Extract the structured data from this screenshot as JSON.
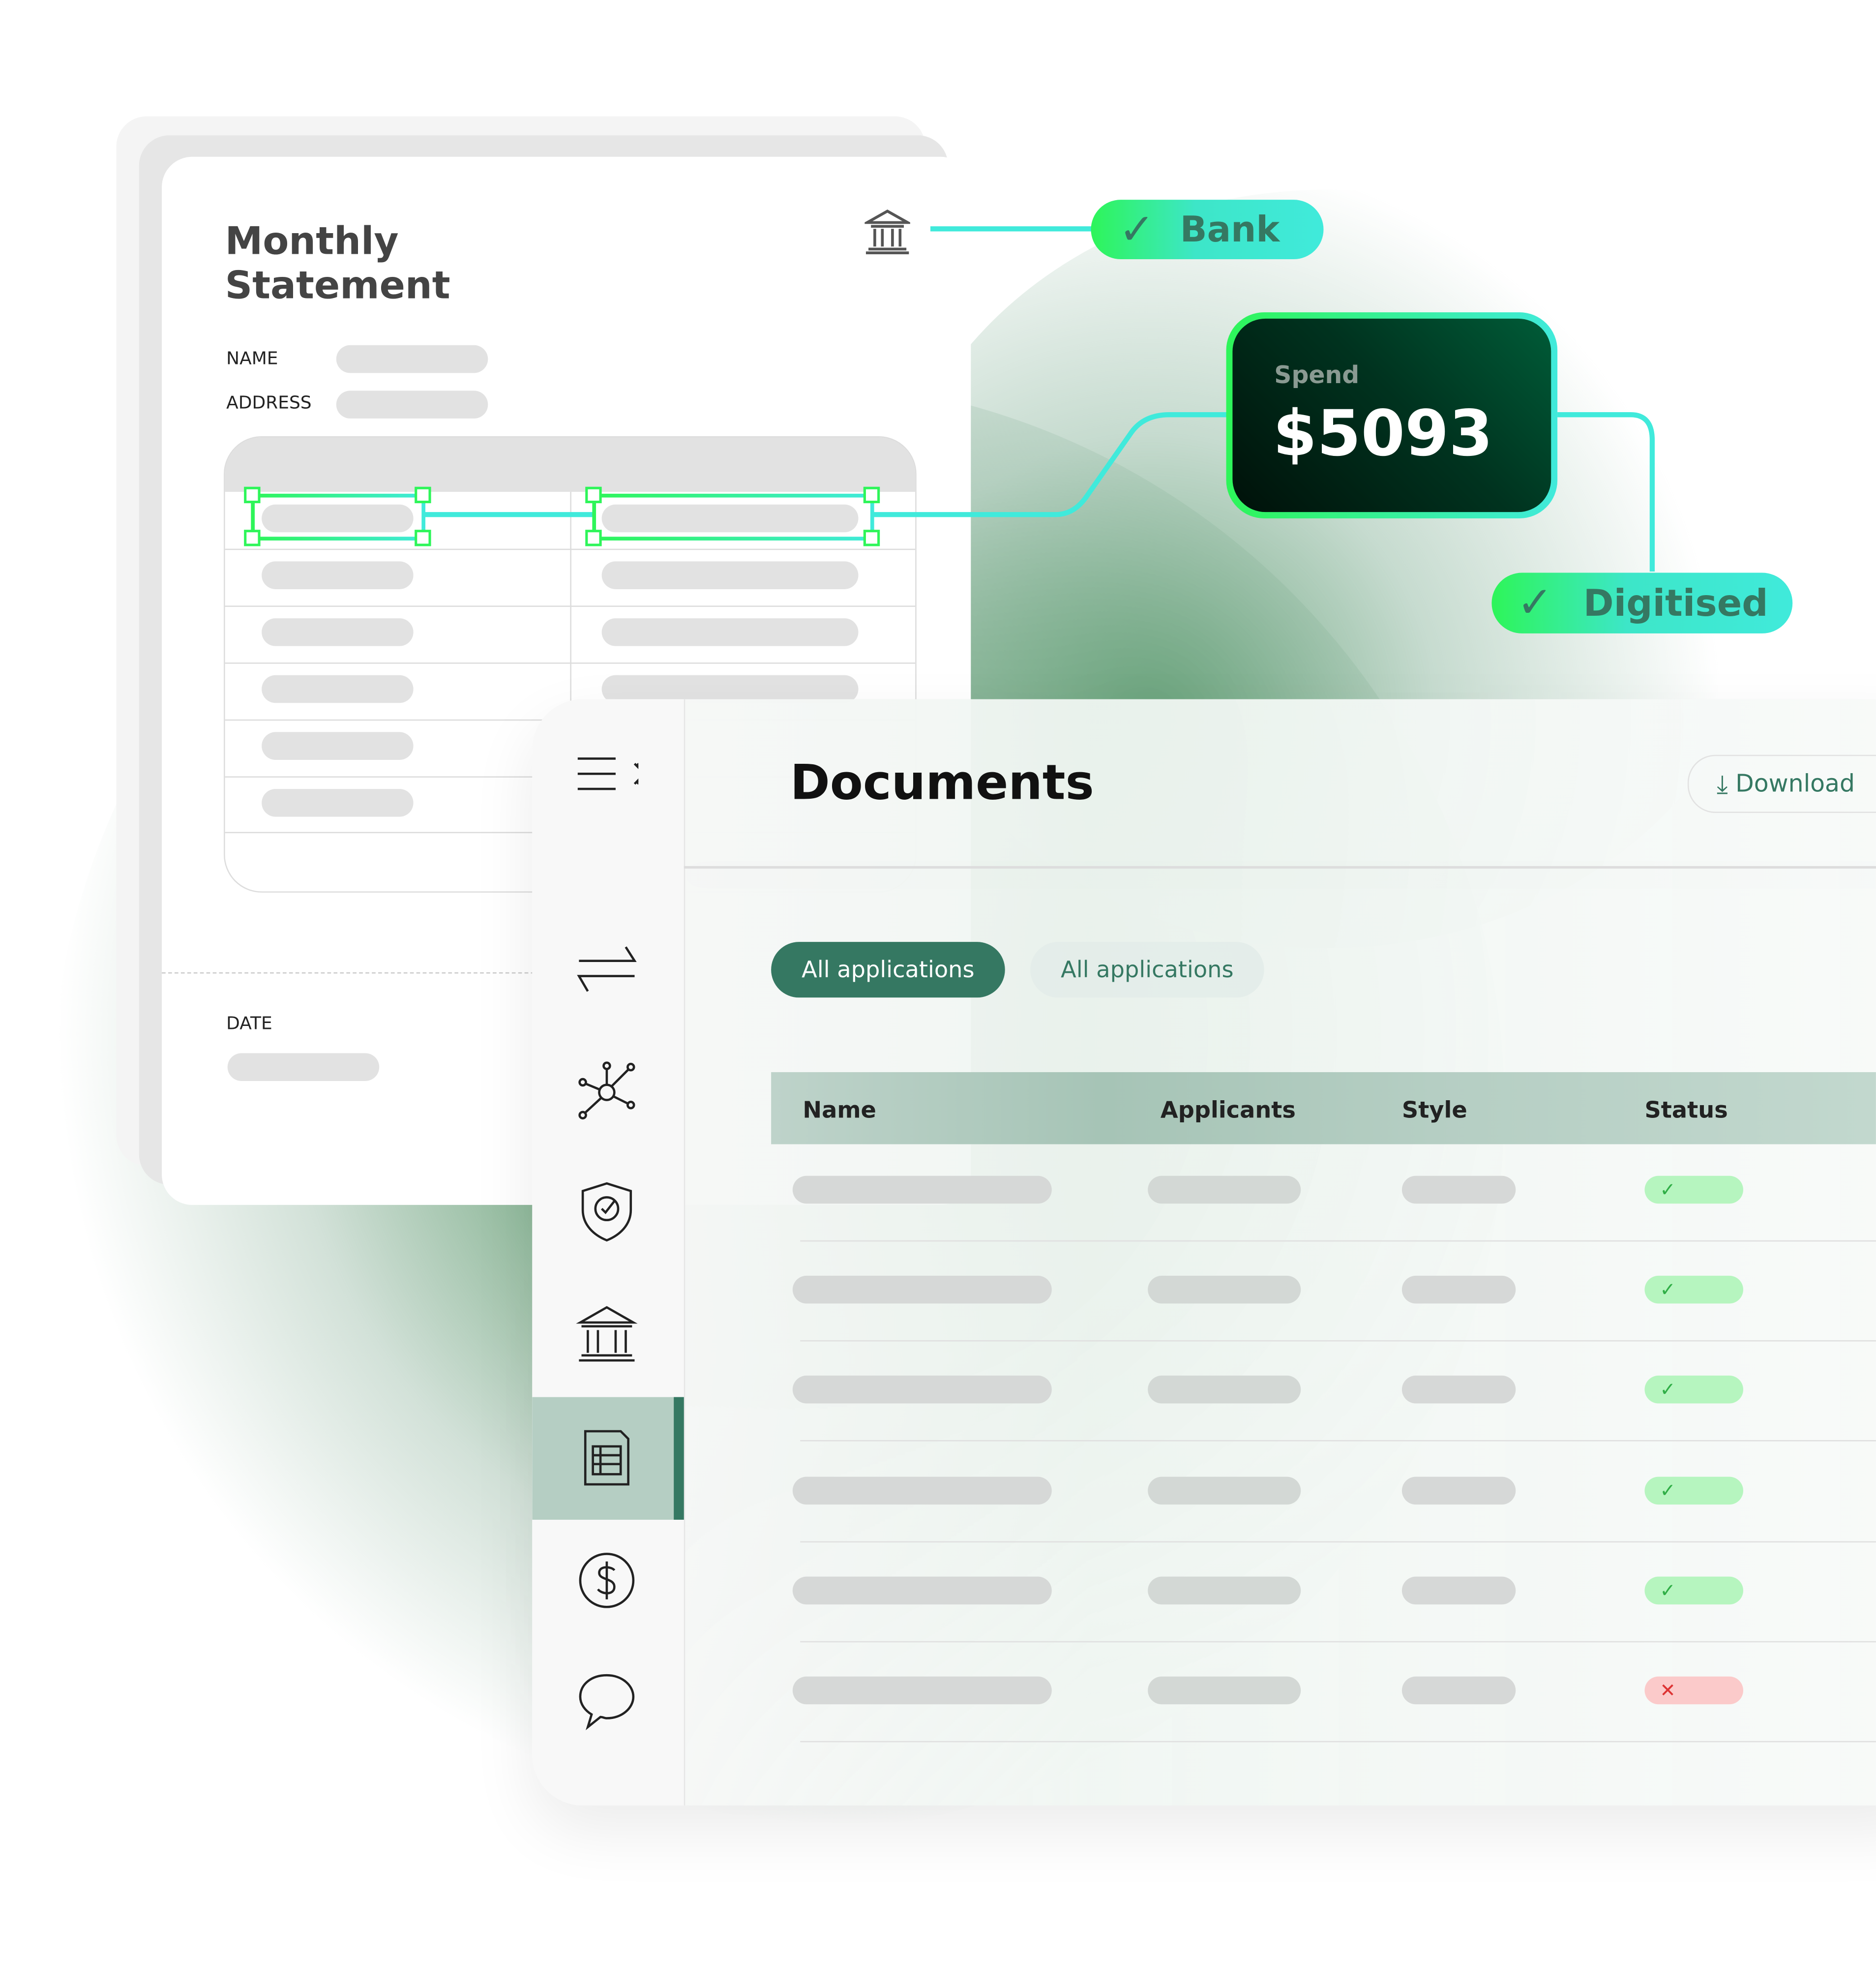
{
  "statement": {
    "title_line1": "Monthly",
    "title_line2": "Statement",
    "name_label": "NAME",
    "address_label": "ADDRESS",
    "date_label": "DATE"
  },
  "tags": {
    "bank": "Bank",
    "digitised": "Digitised"
  },
  "spend": {
    "label": "Spend",
    "value": "$5093"
  },
  "dashboard": {
    "title": "Documents",
    "download_label": "Download",
    "tabs": [
      {
        "label": "All applications",
        "active": true
      },
      {
        "label": "All applications",
        "active": false
      }
    ],
    "columns": [
      "Name",
      "Applicants",
      "Style",
      "Status"
    ],
    "rows": [
      {
        "status": "ok"
      },
      {
        "status": "ok"
      },
      {
        "status": "ok"
      },
      {
        "status": "ok"
      },
      {
        "status": "ok"
      },
      {
        "status": "error"
      }
    ],
    "status_icons": {
      "ok": "✓",
      "error": "✕"
    },
    "sidebar": [
      "menu-expand",
      "transfer",
      "network",
      "shield-check",
      "bank",
      "document",
      "dollar",
      "chat"
    ],
    "active_sidebar": "document"
  },
  "colors": {
    "accent": "#357862",
    "tag_green": "#2ef559",
    "tag_cyan": "#40eadb",
    "ok_bg": "#b6f5bf",
    "error_bg": "#fbcaca",
    "header_bg": "#b5cec3"
  }
}
